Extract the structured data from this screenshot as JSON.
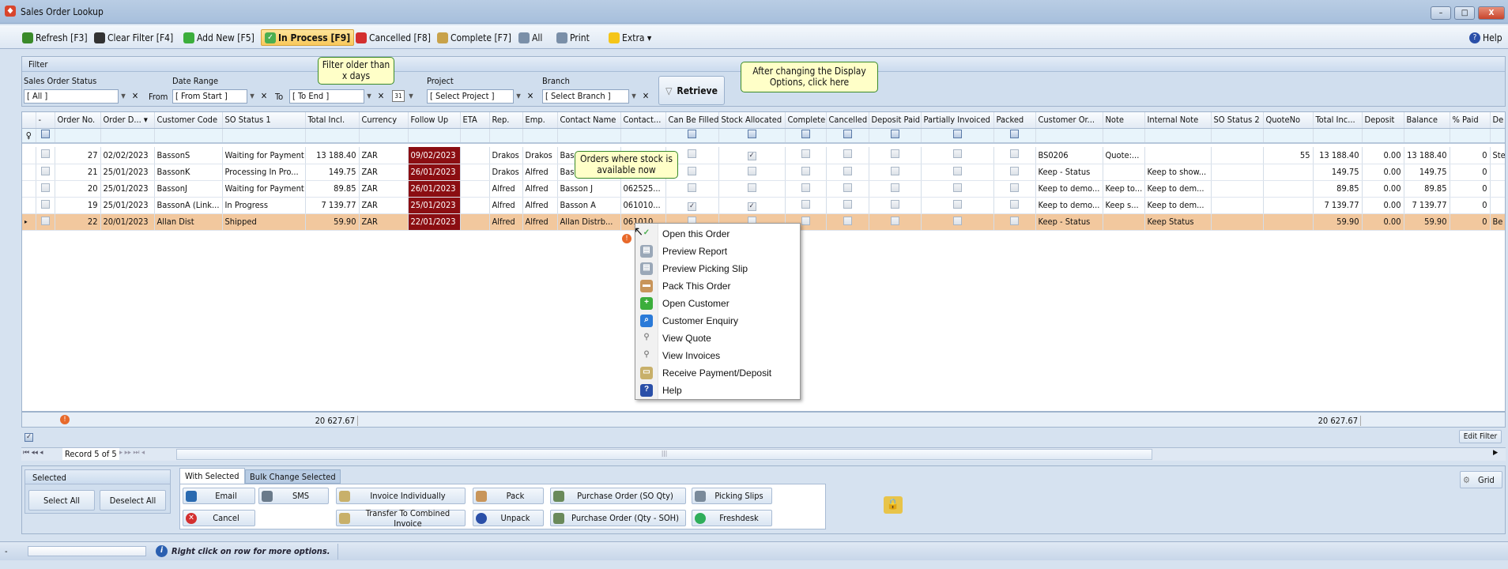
{
  "window": {
    "title": "Sales Order Lookup",
    "minimize": "–",
    "maximize": "□",
    "close": "X"
  },
  "toolbar": {
    "items": [
      {
        "label": "Refresh [F3]",
        "icon": "refresh-icon",
        "color": "#3a8a2a"
      },
      {
        "label": "Clear Filter [F4]",
        "icon": "clear-filter-icon",
        "color": "#333333"
      },
      {
        "label": "Add New [F5]",
        "icon": "plus-icon",
        "color": "#3cae3c"
      },
      {
        "label": "In Process [F9]",
        "icon": "checkmark-icon",
        "color": "#4caf50",
        "selected": true
      },
      {
        "label": "Cancelled [F8]",
        "icon": "cancel-icon",
        "color": "#d32f2f"
      },
      {
        "label": "Complete [F7]",
        "icon": "complete-icon",
        "color": "#c8a24a"
      },
      {
        "label": "All",
        "icon": "globe-icon",
        "color": "#7a8fa8"
      },
      {
        "label": "Print",
        "icon": "printer-icon",
        "color": "#7a8fa8"
      },
      {
        "label": "Extra ▾",
        "icon": "extra-icon",
        "color": "#f5c518"
      }
    ],
    "help": "Help"
  },
  "filter": {
    "title": "Filter",
    "so_status_label": "Sales Order Status",
    "so_status": "[ All ]",
    "date_range_label": "Date Range",
    "from_label": "From",
    "from": "[ From Start ]",
    "to_label": "To",
    "to": "[ To End ]",
    "calendar": "31",
    "project_label": "Project",
    "project": "[ Select Project ]",
    "branch_label": "Branch",
    "branch": "[ Select Branch ]",
    "retrieve": "Retrieve"
  },
  "tooltips": {
    "older": "Filter older than x days",
    "display": "After changing the Display Options, click here",
    "stock": "Orders where stock is available now"
  },
  "grid": {
    "columns": [
      "",
      "-",
      "Order No.",
      "Order D... ▾",
      "Customer Code",
      "SO Status 1",
      "Total Incl.",
      "Currency",
      "Follow Up",
      "ETA",
      "Rep.",
      "Emp.",
      "Contact Name",
      "Contact...",
      "Can Be Filled",
      "Stock Allocated",
      "Complete",
      "Cancelled",
      "Deposit Paid",
      "Partially Invoiced",
      "Packed",
      "Customer Or...",
      "Note",
      "Internal Note",
      "SO Status 2",
      "QuoteNo",
      "Total Inc...",
      "Deposit",
      "Balance",
      "% Paid",
      "De"
    ],
    "rows": [
      [
        "",
        false,
        "27",
        "02/02/2023",
        "BassonS",
        "Waiting for Payment",
        "13 188.40",
        "ZAR",
        "09/02/2023",
        "",
        "Drakos",
        "Drakos",
        "Bas",
        "",
        false,
        true,
        false,
        false,
        false,
        false,
        false,
        "BS0206",
        "Quote:...",
        "",
        "",
        "55",
        "13 188.40",
        "0.00",
        "13 188.40",
        "0",
        "Ste"
      ],
      [
        "",
        false,
        "21",
        "25/01/2023",
        "BassonK",
        "Processing In Pro...",
        "149.75",
        "ZAR",
        "26/01/2023",
        "",
        "Drakos",
        "Alfred",
        "Bas",
        "",
        false,
        false,
        false,
        false,
        false,
        false,
        false,
        "Keep - Status",
        "",
        "Keep to show...",
        "",
        "",
        "149.75",
        "0.00",
        "149.75",
        "0",
        ""
      ],
      [
        "",
        false,
        "20",
        "25/01/2023",
        "BassonJ",
        "Waiting for Payment",
        "89.85",
        "ZAR",
        "26/01/2023",
        "",
        "Alfred",
        "Alfred",
        "Basson J",
        "062525...",
        false,
        false,
        false,
        false,
        false,
        false,
        false,
        "Keep to demo...",
        "Keep to...",
        "Keep to dem...",
        "",
        "",
        "89.85",
        "0.00",
        "89.85",
        "0",
        ""
      ],
      [
        "",
        false,
        "19",
        "25/01/2023",
        "BassonA (Link...",
        "In Progress",
        "7 139.77",
        "ZAR",
        "25/01/2023",
        "",
        "Alfred",
        "Alfred",
        "Basson A",
        "061010...",
        true,
        true,
        false,
        false,
        false,
        false,
        false,
        "Keep to demo...",
        "Keep s...",
        "Keep to dem...",
        "",
        "",
        "7 139.77",
        "0.00",
        "7 139.77",
        "0",
        ""
      ],
      [
        "▸",
        false,
        "22",
        "20/01/2023",
        "Allan Dist",
        "Shipped",
        "59.90",
        "ZAR",
        "22/01/2023",
        "",
        "Alfred",
        "Alfred",
        "Allan Distrb...",
        "061010...",
        false,
        false,
        false,
        false,
        false,
        false,
        false,
        "Keep - Status",
        "",
        "Keep Status",
        "",
        "",
        "59.90",
        "0.00",
        "59.90",
        "0",
        "Be"
      ]
    ],
    "current_row": 4,
    "total_incl_sum": "20 627.67",
    "total_inc_sum": "20 627.67",
    "follow_up_color": "#8b0e12",
    "current_row_color": "#f2c89e"
  },
  "context_menu": [
    {
      "label": "Open this Order",
      "icon": "checkmark-icon",
      "color": "#4caf50"
    },
    {
      "label": "Preview Report",
      "icon": "preview-icon",
      "color": "#9aa8b8"
    },
    {
      "label": "Preview Picking Slip",
      "icon": "preview-icon",
      "color": "#9aa8b8"
    },
    {
      "label": "Pack This Order",
      "icon": "box-icon",
      "color": "#c8955a"
    },
    {
      "label": "Open Customer",
      "icon": "plus-icon",
      "color": "#3cae3c"
    },
    {
      "label": "Customer Enquiry",
      "icon": "search-icon",
      "color": "#2a7ad8"
    },
    {
      "label": "View Quote",
      "icon": "magnifier-icon",
      "color": "#888888"
    },
    {
      "label": "View Invoices",
      "icon": "magnifier-icon",
      "color": "#888888"
    },
    {
      "label": "Receive Payment/Deposit",
      "icon": "cash-register-icon",
      "color": "#c8b06a"
    },
    {
      "label": "Help",
      "icon": "help-icon",
      "color": "#2a4fa8"
    }
  ],
  "navigator": {
    "record": "Record 5 of 5"
  },
  "edit_filter": "Edit Filter",
  "bottom": {
    "selected_title": "Selected",
    "select_all": "Select All",
    "deselect_all": "Deselect All",
    "tabs": [
      "With Selected",
      "Bulk Change Selected"
    ],
    "buttons": [
      {
        "label": "Email",
        "icon": "email-icon",
        "color": "#2a6ab0"
      },
      {
        "label": "SMS",
        "icon": "phone-icon",
        "color": "#6a7a8a"
      },
      {
        "label": "Invoice Individually",
        "icon": "invoice-icon",
        "color": "#c8b06a"
      },
      {
        "label": "Pack",
        "icon": "box-icon",
        "color": "#c8955a"
      },
      {
        "label": "Purchase Order (SO Qty)",
        "icon": "truck-icon",
        "color": "#6a8a5a"
      },
      {
        "label": "Picking Slips",
        "icon": "printer-icon",
        "color": "#7a8a9a"
      },
      {
        "label": "Cancel",
        "icon": "cancel-icon",
        "color": "#d32f2f"
      },
      {
        "label": "Transfer To Combined Invoice",
        "icon": "invoice-icon",
        "color": "#c8b06a"
      },
      {
        "label": "Unpack",
        "icon": "unpack-icon",
        "color": "#2a4fa8"
      },
      {
        "label": "Purchase Order (Qty - SOH)",
        "icon": "truck-icon",
        "color": "#6a8a5a"
      },
      {
        "label": "Freshdesk",
        "icon": "freshdesk-icon",
        "color": "#2fae5a"
      }
    ],
    "grid_button": "Grid"
  },
  "status": {
    "dash": "-",
    "hint": "Right click on row for more options."
  }
}
